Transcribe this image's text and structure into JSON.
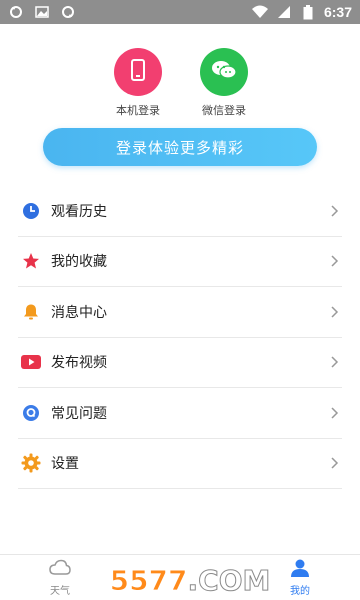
{
  "status_bar": {
    "time": "6:37"
  },
  "login": {
    "phone_label": "本机登录",
    "wechat_label": "微信登录",
    "button_label": "登录体验更多精彩"
  },
  "menu": {
    "items": [
      {
        "label": "观看历史",
        "icon": "clock-icon",
        "color": "#2f6fe0"
      },
      {
        "label": "我的收藏",
        "icon": "star-icon",
        "color": "#e8334a"
      },
      {
        "label": "消息中心",
        "icon": "bell-icon",
        "color": "#f39a1d"
      },
      {
        "label": "发布视频",
        "icon": "play-icon",
        "color": "#e8334a"
      },
      {
        "label": "常见问题",
        "icon": "question-icon",
        "color": "#3b7ce8"
      },
      {
        "label": "设置",
        "icon": "gear-icon",
        "color": "#f39a1d"
      }
    ]
  },
  "tabbar": {
    "weather_label": "天气",
    "mine_label": "我的"
  },
  "watermark": {
    "num": "5577",
    "dot": ".",
    "com": "COM"
  }
}
